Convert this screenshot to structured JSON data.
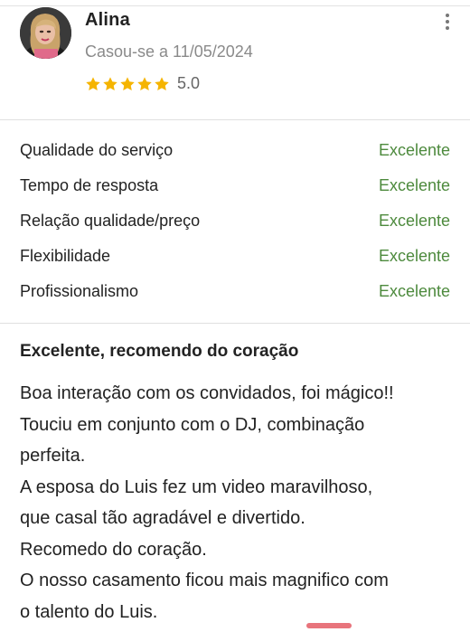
{
  "review": {
    "author": {
      "name": "Alina",
      "married_text": "Casou-se a 11/05/2024",
      "avatar_icon": "user-avatar-photo"
    },
    "rating": {
      "stars": 5,
      "max_stars": 5,
      "value_text": "5.0",
      "star_color": "#f5b400"
    },
    "menu_icon": "more-vertical-icon",
    "criteria": [
      {
        "label": "Qualidade do serviço",
        "value": "Excelente"
      },
      {
        "label": "Tempo de resposta",
        "value": "Excelente"
      },
      {
        "label": "Relação qualidade/preço",
        "value": "Excelente"
      },
      {
        "label": "Flexibilidade",
        "value": "Excelente"
      },
      {
        "label": "Profissionalismo",
        "value": "Excelente"
      }
    ],
    "criteria_value_color": "#4d8a3d",
    "title": "Excelente, recomendo do coração",
    "body_lines": [
      "Boa interação com os convidados, foi mágico!!",
      "Touciu em conjunto com o DJ, combinação",
      "perfeita.",
      "A esposa do Luis fez um video maravilhoso,",
      "que casal tão agradável e divertido.",
      "Recomedo do coração.",
      "O nosso casamento ficou mais magnifico com",
      "o talento do Luis."
    ]
  }
}
